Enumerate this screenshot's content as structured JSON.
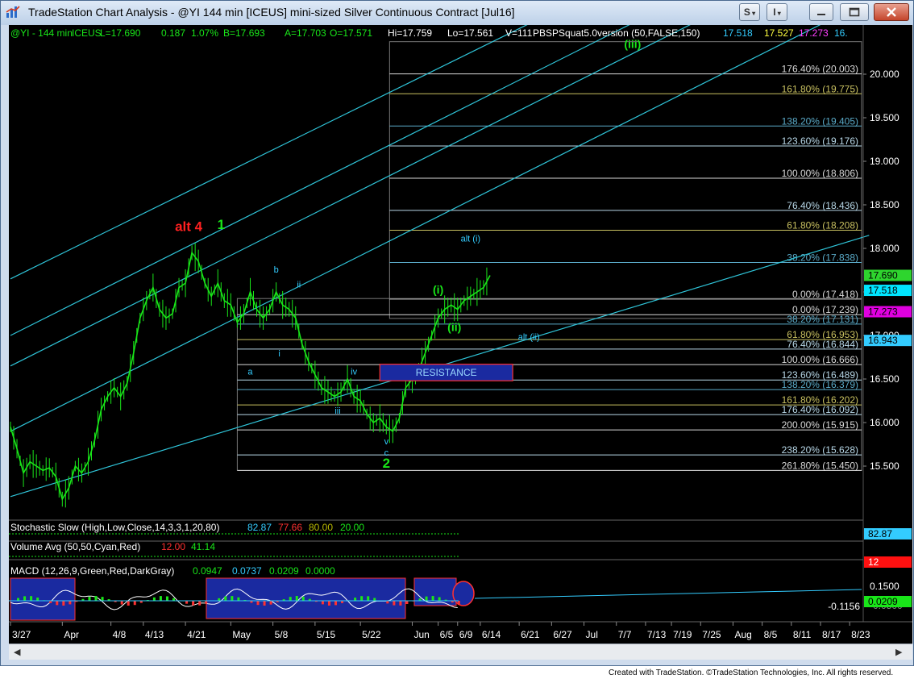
{
  "window": {
    "title": "TradeStation Chart Analysis - @YI 144 min [ICEUS] mini-sized Silver Continuous Contract [Jul16]",
    "btn_s": "S",
    "btn_i": "I",
    "footer": "Created with TradeStation. ©TradeStation Technologies, Inc. All rights reserved."
  },
  "chart_data": {
    "type": "line",
    "title": "",
    "header": {
      "symbol": "@YI - 144 min",
      "exchange": "ICEUS",
      "last": "L=17.690",
      "chg": "0.187",
      "pct": "1.07%",
      "bid": "B=17.693",
      "ask": "A=17.703",
      "open": "O=17.571",
      "high": "Hi=17.759",
      "low": "Lo=17.561",
      "vol": "V=111",
      "indicator": "PBSPSquat5.0version (50,FALSE,150)",
      "ind_v1": "17.518",
      "ind_v2": "17.527",
      "ind_v3": "17.273",
      "ind_v4": "16."
    },
    "price_axis": {
      "ylim": [
        15.1,
        20.4
      ],
      "ticks": [
        "15.500",
        "16.000",
        "16.500",
        "17.000",
        "17.500",
        "18.000",
        "18.500",
        "19.000",
        "19.500",
        "20.000"
      ],
      "tick_values": [
        15.5,
        16.0,
        16.5,
        17.0,
        17.5,
        18.0,
        18.5,
        19.0,
        19.5,
        20.0
      ]
    },
    "price_flags": [
      {
        "label": "17.690",
        "value": 17.69,
        "color": "#2ed52e"
      },
      {
        "label": "17.518",
        "value": 17.518,
        "color": "#00e5ff"
      },
      {
        "label": "17.273",
        "value": 17.273,
        "color": "#e000e0"
      },
      {
        "label": "16.943",
        "value": 16.943,
        "color": "#33ccff"
      }
    ],
    "x_axis": {
      "labels": [
        "3/27",
        "Apr",
        "4/8",
        "4/13",
        "4/21",
        "May",
        "5/8",
        "5/15",
        "5/22",
        "Jun",
        "6/5",
        "6/9",
        "6/14",
        "6/21",
        "6/27",
        "Jul",
        "7/7",
        "7/13",
        "7/19",
        "7/25",
        "Aug",
        "8/5",
        "8/11",
        "8/17",
        "8/23"
      ],
      "bar_index": [
        0,
        16,
        31,
        41,
        54,
        68,
        81,
        94,
        108,
        124,
        132,
        138,
        145,
        157,
        167,
        177,
        187,
        196,
        204,
        213,
        223,
        232,
        241,
        250,
        259
      ]
    },
    "series": [
      {
        "name": "@YI",
        "color": "#19e619",
        "x": [
          0,
          2,
          4,
          6,
          8,
          10,
          12,
          14,
          16,
          18,
          20,
          22,
          24,
          26,
          28,
          30,
          32,
          34,
          36,
          38,
          40,
          42,
          44,
          46,
          48,
          50,
          52,
          54,
          56,
          58,
          60,
          62,
          64,
          66,
          68,
          70,
          72,
          74,
          76,
          78,
          80,
          82,
          84,
          86,
          88,
          90,
          92,
          94,
          96,
          98,
          100,
          102,
          104,
          106,
          108,
          110,
          112,
          114,
          116,
          118,
          120,
          122,
          124,
          126,
          128,
          130,
          132,
          134,
          136,
          138,
          140,
          142,
          144,
          146,
          148
        ],
        "values": [
          15.95,
          15.7,
          15.42,
          15.55,
          15.5,
          15.45,
          15.48,
          15.38,
          15.12,
          15.25,
          15.5,
          15.42,
          15.55,
          15.8,
          16.15,
          16.3,
          16.4,
          16.3,
          16.45,
          16.8,
          17.2,
          17.4,
          17.55,
          17.3,
          17.2,
          17.25,
          17.55,
          17.6,
          17.95,
          17.85,
          17.6,
          17.45,
          17.6,
          17.4,
          17.35,
          17.15,
          17.25,
          17.5,
          17.3,
          17.2,
          17.3,
          17.5,
          17.35,
          17.3,
          17.2,
          16.9,
          16.7,
          16.55,
          16.4,
          16.35,
          16.3,
          16.35,
          16.5,
          16.3,
          16.25,
          16.1,
          16.0,
          16.05,
          15.95,
          15.9,
          16.05,
          16.4,
          16.5,
          16.6,
          16.8,
          17.0,
          17.2,
          17.3,
          17.35,
          17.3,
          17.4,
          17.45,
          17.5,
          17.55,
          17.69
        ]
      }
    ],
    "fib_levels_right": [
      {
        "label": "176.40% (20.003)",
        "value": 20.003,
        "color": "#d8d8d8"
      },
      {
        "label": "161.80% (19.775)",
        "value": 19.775,
        "color": "#c8c060"
      },
      {
        "label": "138.20% (19.405)",
        "value": 19.405,
        "color": "#5aaac8"
      },
      {
        "label": "123.60% (19.176)",
        "value": 19.176,
        "color": "#b8d8e8"
      },
      {
        "label": "100.00% (18.806)",
        "value": 18.806,
        "color": "#d8d8d8"
      },
      {
        "label": "76.40% (18.436)",
        "value": 18.436,
        "color": "#b8d8e8"
      },
      {
        "label": "61.80% (18.208)",
        "value": 18.208,
        "color": "#c8c060"
      },
      {
        "label": "38.20% (17.838)",
        "value": 17.838,
        "color": "#5aaac8"
      },
      {
        "label": "0.00% (17.418)",
        "value": 17.418,
        "color": "#d8d8d8"
      }
    ],
    "fib_levels_lower": [
      {
        "label": "0.00% (17.239)",
        "value": 17.239,
        "color": "#d8d8d8"
      },
      {
        "label": "38.20% (17.131)",
        "value": 17.131,
        "color": "#5aaac8"
      },
      {
        "label": "61.80% (16.953)",
        "value": 16.953,
        "color": "#c8c060"
      },
      {
        "label": "76.40% (16.844)",
        "value": 16.844,
        "color": "#b8d8e8"
      },
      {
        "label": "100.00% (16.666)",
        "value": 16.666,
        "color": "#d8d8d8"
      },
      {
        "label": "123.60% (16.489)",
        "value": 16.489,
        "color": "#b8d8e8"
      },
      {
        "label": "138.20% (16.379)",
        "value": 16.379,
        "color": "#5aaac8"
      },
      {
        "label": "161.80% (16.202)",
        "value": 16.202,
        "color": "#c8c060"
      },
      {
        "label": "176.40% (16.092)",
        "value": 16.092,
        "color": "#b8d8e8"
      },
      {
        "label": "200.00% (15.915)",
        "value": 15.915,
        "color": "#d8d8d8"
      },
      {
        "label": "238.20% (15.628)",
        "value": 15.628,
        "color": "#b8d8e8"
      },
      {
        "label": "261.80% (15.450)",
        "value": 15.45,
        "color": "#d8d8d8"
      }
    ],
    "wave_labels": [
      {
        "text": "alt 4",
        "x": 55,
        "y": 18.2,
        "color": "#ff2020",
        "size": "big"
      },
      {
        "text": "1",
        "x": 65,
        "y": 18.22,
        "color": "#19e619",
        "size": "big"
      },
      {
        "text": "(iii)",
        "x": 192,
        "y": 20.3,
        "color": "#19e619",
        "size": "mid"
      },
      {
        "text": "alt (i)",
        "x": 142,
        "y": 18.08,
        "color": "#33ccff",
        "size": "small"
      },
      {
        "text": "(i)",
        "x": 132,
        "y": 17.48,
        "color": "#19e619",
        "size": "mid"
      },
      {
        "text": "(ii)",
        "x": 137,
        "y": 17.05,
        "color": "#19e619",
        "size": "mid"
      },
      {
        "text": "alt (ii)",
        "x": 160,
        "y": 16.95,
        "color": "#33ccff",
        "size": "small"
      },
      {
        "text": "b",
        "x": 82,
        "y": 17.72,
        "color": "#33ccff",
        "size": "small"
      },
      {
        "text": "ii",
        "x": 89,
        "y": 17.55,
        "color": "#33ccff",
        "size": "small"
      },
      {
        "text": "i",
        "x": 83,
        "y": 16.76,
        "color": "#33ccff",
        "size": "small"
      },
      {
        "text": "a",
        "x": 74,
        "y": 16.55,
        "color": "#33ccff",
        "size": "small"
      },
      {
        "text": "iv",
        "x": 106,
        "y": 16.55,
        "color": "#33ccff",
        "size": "small"
      },
      {
        "text": "iii",
        "x": 101,
        "y": 16.1,
        "color": "#33ccff",
        "size": "small"
      },
      {
        "text": "v",
        "x": 116,
        "y": 15.75,
        "color": "#33ccff",
        "size": "small"
      },
      {
        "text": "c",
        "x": 116,
        "y": 15.62,
        "color": "#33ccff",
        "size": "small"
      },
      {
        "text": "2",
        "x": 116,
        "y": 15.48,
        "color": "#19e619",
        "size": "big"
      }
    ],
    "resistance": {
      "label": "RESISTANCE",
      "x0": 114,
      "x1": 155,
      "y0": 16.48,
      "y1": 16.67
    },
    "stochastic": {
      "label": "Stochastic Slow (High,Low,Close,14,3,3,1,20,80)",
      "v1": "82.87",
      "v2": "77.66",
      "v3": "80.00",
      "v4": "20.00",
      "flag": "82.87"
    },
    "volume": {
      "label": "Volume Avg (50,50,Cyan,Red)",
      "v1": "12.00",
      "v2": "41.14",
      "flag": "12"
    },
    "macd": {
      "label": "MACD (12,26,9,Green,Red,DarkGray)",
      "v1": "0.0947",
      "v2": "0.0737",
      "v3": "0.0209",
      "v4": "0.0000",
      "tick1": "0.1500",
      "tick2": "-0.1156",
      "tick3": "-0.0500",
      "flag": "0.0209"
    }
  }
}
